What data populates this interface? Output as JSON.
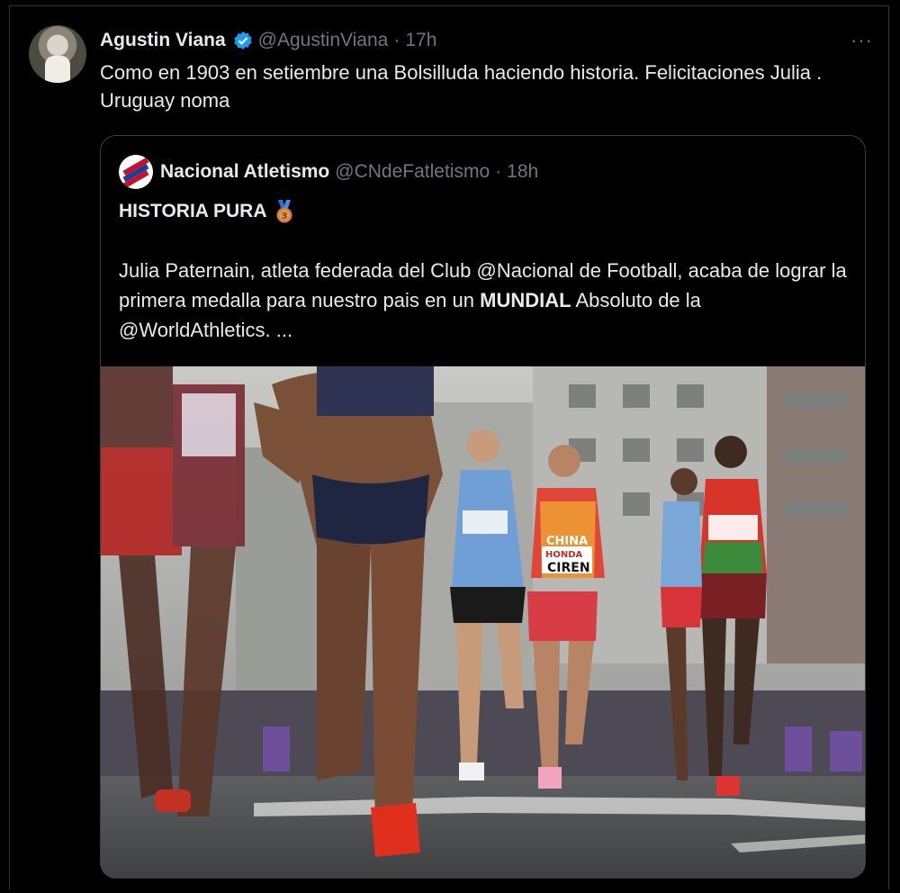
{
  "tweet": {
    "author_name": "Agustin Viana",
    "handle": "@AgustinViana",
    "separator": "·",
    "time": "17h",
    "more_label": "···",
    "text": "Como en 1903 en setiembre una Bolsilluda haciendo historia. Felicitaciones Julia . Uruguay noma"
  },
  "quoted": {
    "author_name": "Nacional Atletismo",
    "handle": "@CNdeFatletismo",
    "separator": "·",
    "time": "18h",
    "title": "HISTORIA PURA",
    "body_pre": "Julia Paternain, atleta federada del Club @Nacional de Football, acaba de lograr la primera medalla para nuestro pais en un ",
    "body_bold": "MUNDIAL",
    "body_post": " Absoluto de la @WorldAthletics. ...",
    "photo_bibs": [
      "CHINA",
      "HONDA",
      "CIREN"
    ]
  },
  "colors": {
    "background": "#000000",
    "text": "#e7e9ea",
    "muted": "#71767b",
    "verified": "#1d9bf0",
    "border": "#2f3336"
  }
}
